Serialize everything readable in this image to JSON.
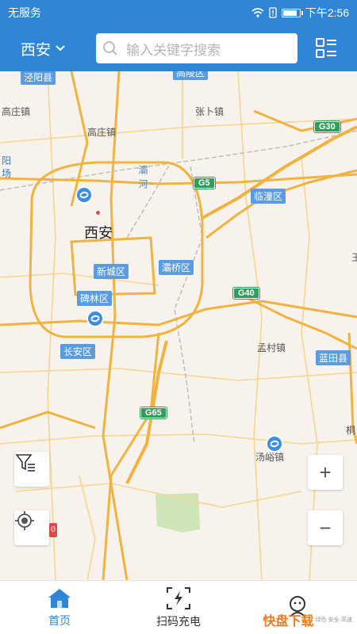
{
  "status_bar": {
    "carrier": "无服务",
    "time": "下午2:56",
    "battery_level": 0.8
  },
  "header": {
    "city": "西安",
    "search_placeholder": "输入关键字搜索"
  },
  "map": {
    "city_label": "西安",
    "place_labels": [
      "泾阳县",
      "高陵区",
      "高庄镇",
      "张卜镇",
      "高庄镇",
      "阳",
      "场",
      "孟村镇",
      "汤峪镇",
      "桐",
      "王"
    ],
    "district_labels": [
      "临潼区",
      "新城区",
      "灞桥区",
      "碑林区",
      "长安区",
      "蓝田县"
    ],
    "river_label": "灞河",
    "highway_shields": [
      "G30",
      "G5",
      "G40",
      "G65"
    ],
    "zoom_in": "+",
    "zoom_out": "−",
    "small_badge": "0"
  },
  "tabbar": {
    "tabs": [
      {
        "label": "首页",
        "active": true
      },
      {
        "label": "扫码充电",
        "active": false
      },
      {
        "label": "",
        "active": false
      }
    ],
    "watermark": {
      "big": "快盘下载",
      "small": "绿色·安全·高速"
    }
  },
  "colors": {
    "primary": "#2f86d6",
    "highway": "#2f9e58",
    "district": "#5b9be0"
  }
}
